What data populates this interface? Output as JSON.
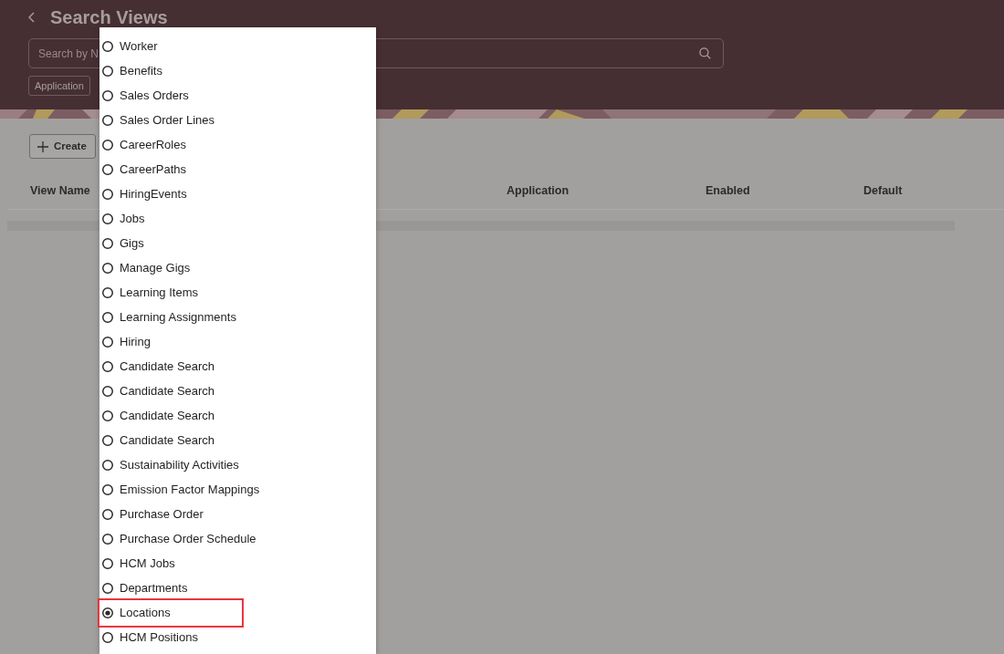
{
  "page": {
    "title": "Search Views"
  },
  "search": {
    "placeholder": "Search by N"
  },
  "filters": [
    {
      "label": "Application"
    }
  ],
  "toolbar": {
    "create_button": "Create"
  },
  "table": {
    "columns": [
      "View Name",
      "Application",
      "Enabled",
      "Default"
    ]
  },
  "dropdown": {
    "options": [
      {
        "label": "Worker",
        "selected": false,
        "highlighted": false
      },
      {
        "label": "Benefits",
        "selected": false,
        "highlighted": false
      },
      {
        "label": "Sales Orders",
        "selected": false,
        "highlighted": false
      },
      {
        "label": "Sales Order Lines",
        "selected": false,
        "highlighted": false
      },
      {
        "label": "CareerRoles",
        "selected": false,
        "highlighted": false
      },
      {
        "label": "CareerPaths",
        "selected": false,
        "highlighted": false
      },
      {
        "label": "HiringEvents",
        "selected": false,
        "highlighted": false
      },
      {
        "label": "Jobs",
        "selected": false,
        "highlighted": false
      },
      {
        "label": "Gigs",
        "selected": false,
        "highlighted": false
      },
      {
        "label": "Manage Gigs",
        "selected": false,
        "highlighted": false
      },
      {
        "label": "Learning Items",
        "selected": false,
        "highlighted": false
      },
      {
        "label": "Learning Assignments",
        "selected": false,
        "highlighted": false
      },
      {
        "label": "Hiring",
        "selected": false,
        "highlighted": false
      },
      {
        "label": "Candidate Search",
        "selected": false,
        "highlighted": false
      },
      {
        "label": "Candidate Search",
        "selected": false,
        "highlighted": false
      },
      {
        "label": "Candidate Search",
        "selected": false,
        "highlighted": false
      },
      {
        "label": "Candidate Search",
        "selected": false,
        "highlighted": false
      },
      {
        "label": "Sustainability Activities",
        "selected": false,
        "highlighted": false
      },
      {
        "label": "Emission Factor Mappings",
        "selected": false,
        "highlighted": false
      },
      {
        "label": "Purchase Order",
        "selected": false,
        "highlighted": false
      },
      {
        "label": "Purchase Order Schedule",
        "selected": false,
        "highlighted": false
      },
      {
        "label": "HCM Jobs",
        "selected": false,
        "highlighted": false
      },
      {
        "label": "Departments",
        "selected": false,
        "highlighted": false
      },
      {
        "label": "Locations",
        "selected": true,
        "highlighted": true
      },
      {
        "label": "HCM Positions",
        "selected": false,
        "highlighted": false
      }
    ]
  }
}
